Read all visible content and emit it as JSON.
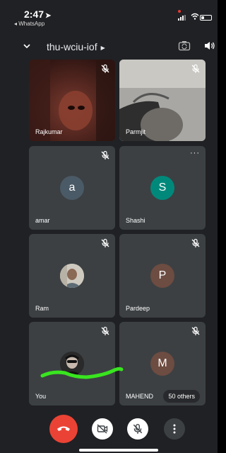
{
  "status_bar": {
    "time": "2:47",
    "back_app": "◂ WhatsApp"
  },
  "header": {
    "meeting_code": "thu-wciu-iof",
    "chevron": "chevron-down-icon",
    "code_arrow": "play-arrow-icon",
    "camera_switch": "camera-switch-icon",
    "speaker": "speaker-icon"
  },
  "participants": [
    {
      "name": "Rajkumar",
      "muted": true,
      "video": true
    },
    {
      "name": "Parmjit",
      "muted": true,
      "video": true
    },
    {
      "name": "amar",
      "initial": "a",
      "avatar_color": "#4a5a66",
      "muted": true
    },
    {
      "name": "Shashi",
      "initial": "S",
      "avatar_color": "#00897b",
      "muted": false,
      "more_options": "···"
    },
    {
      "name": "Ram",
      "muted": true,
      "photo_avatar": true
    },
    {
      "name": "Pardeep",
      "initial": "P",
      "avatar_color": "#6d4c41",
      "muted": true
    },
    {
      "name": "You",
      "muted": true,
      "photo_avatar": true
    },
    {
      "name": "MAHEND",
      "initial": "M",
      "avatar_color": "#6d4c41",
      "muted": true
    }
  ],
  "others_badge": "50 others",
  "controls": {
    "end_call": "end-call-icon",
    "camera": "camera-off-icon",
    "mic": "mic-off-icon",
    "more": "more-vert-icon"
  },
  "colors": {
    "background": "#202124",
    "tile": "#3c4043",
    "end_call": "#ea4335",
    "annotation": "#39e51f"
  }
}
